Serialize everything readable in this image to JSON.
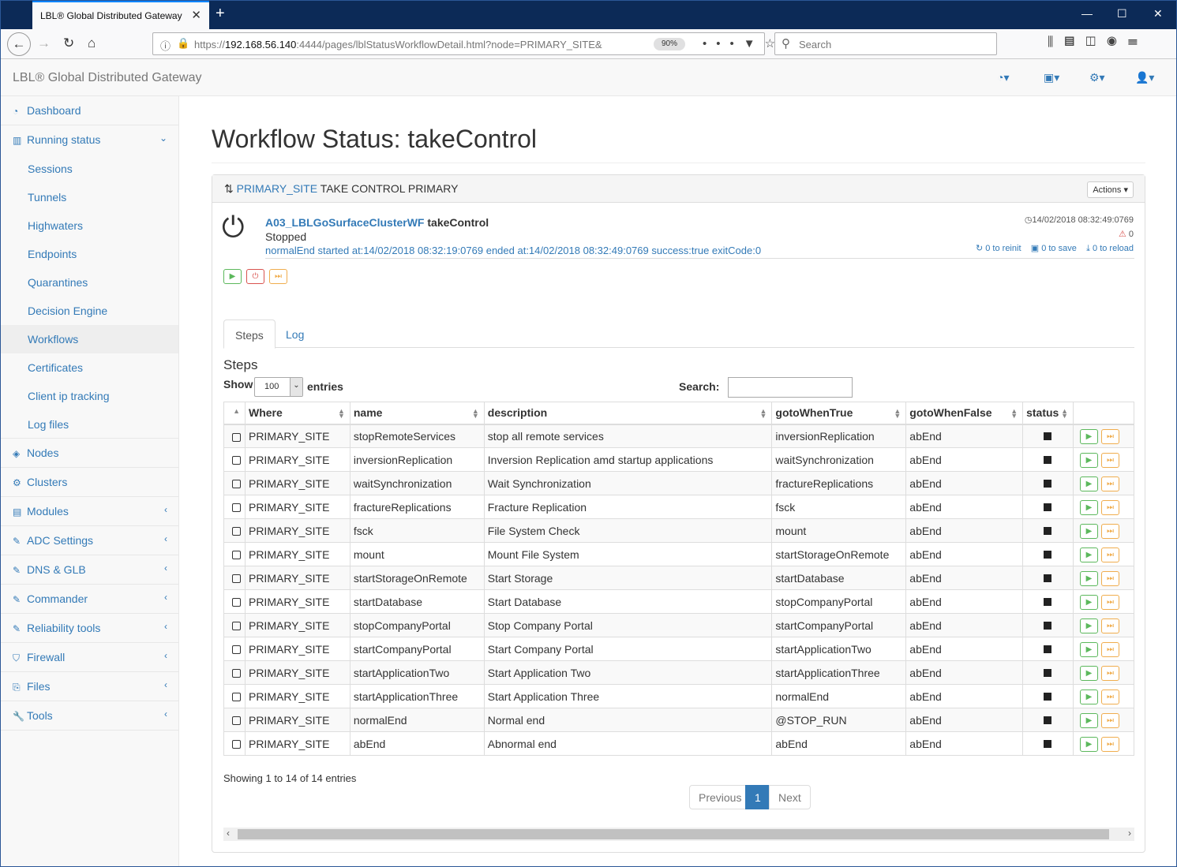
{
  "browser": {
    "tab_title": "LBL® Global Distributed Gateway",
    "url_prefix": "https://",
    "url_host": "192.168.56.140",
    "url_rest": ":4444/pages/lblStatusWorkflowDetail.html?node=PRIMARY_SITE&",
    "zoom": "90%",
    "search_placeholder": "Search"
  },
  "app": {
    "brand": "LBL® Global Distributed Gateway"
  },
  "sidebar": {
    "dashboard": "Dashboard",
    "running_status": "Running status",
    "sub_items": [
      "Sessions",
      "Tunnels",
      "Highwaters",
      "Endpoints",
      "Quarantines",
      "Decision Engine",
      "Workflows",
      "Certificates",
      "Client ip tracking",
      "Log files"
    ],
    "nodes": "Nodes",
    "clusters": "Clusters",
    "modules": "Modules",
    "adc_settings": "ADC Settings",
    "dns_glb": "DNS & GLB",
    "commander": "Commander",
    "reliability_tools": "Reliability tools",
    "firewall": "Firewall",
    "files": "Files",
    "tools": "Tools"
  },
  "page": {
    "title": "Workflow Status: takeControl"
  },
  "panel": {
    "site_link": "PRIMARY_SITE",
    "heading_rest": " TAKE CONTROL PRIMARY",
    "actions_label": "Actions",
    "workflow_link": "A03_LBLGoSurfaceClusterWF",
    "workflow_name": "takeControl",
    "state": "Stopped",
    "info": "normalEnd started at:14/02/2018 08:32:19:0769 ended at:14/02/2018 08:32:49:0769 success:true exitCode:0",
    "timestamp": "14/02/2018 08:32:49:0769",
    "warnings": "0",
    "reinit": "0 to reinit",
    "save": "0 to save",
    "reload": "0 to reload"
  },
  "tabs": {
    "steps": "Steps",
    "log": "Log"
  },
  "steps": {
    "heading": "Steps",
    "show_label": "Show",
    "entries_value": "100",
    "entries_label": "entries",
    "search_label": "Search:",
    "columns": [
      "Where",
      "name",
      "description",
      "gotoWhenTrue",
      "gotoWhenFalse",
      "status"
    ],
    "rows": [
      [
        "PRIMARY_SITE",
        "stopRemoteServices",
        "stop all remote services",
        "inversionReplication",
        "abEnd"
      ],
      [
        "PRIMARY_SITE",
        "inversionReplication",
        "Inversion Replication amd startup applications",
        "waitSynchronization",
        "abEnd"
      ],
      [
        "PRIMARY_SITE",
        "waitSynchronization",
        "Wait Synchronization",
        "fractureReplications",
        "abEnd"
      ],
      [
        "PRIMARY_SITE",
        "fractureReplications",
        "Fracture Replication",
        "fsck",
        "abEnd"
      ],
      [
        "PRIMARY_SITE",
        "fsck",
        "File System Check",
        "mount",
        "abEnd"
      ],
      [
        "PRIMARY_SITE",
        "mount",
        "Mount File System",
        "startStorageOnRemote",
        "abEnd"
      ],
      [
        "PRIMARY_SITE",
        "startStorageOnRemote",
        "Start Storage",
        "startDatabase",
        "abEnd"
      ],
      [
        "PRIMARY_SITE",
        "startDatabase",
        "Start Database",
        "stopCompanyPortal",
        "abEnd"
      ],
      [
        "PRIMARY_SITE",
        "stopCompanyPortal",
        "Stop Company Portal",
        "startCompanyPortal",
        "abEnd"
      ],
      [
        "PRIMARY_SITE",
        "startCompanyPortal",
        "Start Company Portal",
        "startApplicationTwo",
        "abEnd"
      ],
      [
        "PRIMARY_SITE",
        "startApplicationTwo",
        "Start Application Two",
        "startApplicationThree",
        "abEnd"
      ],
      [
        "PRIMARY_SITE",
        "startApplicationThree",
        "Start Application Three",
        "normalEnd",
        "abEnd"
      ],
      [
        "PRIMARY_SITE",
        "normalEnd",
        "Normal end",
        "@STOP_RUN",
        "abEnd"
      ],
      [
        "PRIMARY_SITE",
        "abEnd",
        "Abnormal end",
        "abEnd",
        "abEnd"
      ]
    ],
    "showing": "Showing 1 to 14 of 14 entries",
    "prev": "Previous",
    "page": "1",
    "next": "Next"
  },
  "colors": {
    "link": "#337ab7",
    "start": "#5cb85c",
    "stop": "#d9534f",
    "step": "#f0ad4e",
    "titlebar": "#0c2a57"
  }
}
